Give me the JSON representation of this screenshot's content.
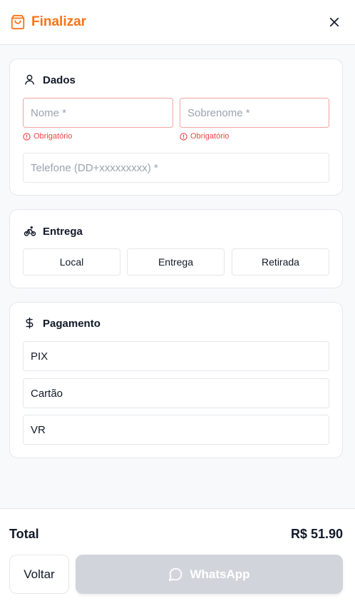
{
  "header": {
    "title": "Finalizar",
    "icon": "shopping-bag-icon",
    "close_icon": "close-icon",
    "accent_color": "#f97316"
  },
  "dados": {
    "title": "Dados",
    "icon": "user-icon",
    "nome_placeholder": "Nome *",
    "sobrenome_placeholder": "Sobrenome *",
    "nome_error": "Obrigatório",
    "sobrenome_error": "Obrigatório",
    "telefone_placeholder": "Telefone (DD+xxxxxxxxx) *",
    "error_color": "#ef4444"
  },
  "entrega": {
    "title": "Entrega",
    "icon": "bicycle-icon",
    "options": [
      "Local",
      "Entrega",
      "Retirada"
    ]
  },
  "pagamento": {
    "title": "Pagamento",
    "icon": "dollar-icon",
    "options": [
      "PIX",
      "Cartão",
      "VR"
    ]
  },
  "footer": {
    "total_label": "Total",
    "total_value": "R$ 51.90",
    "back_label": "Voltar",
    "whatsapp_label": "WhatsApp",
    "whatsapp_icon": "chat-bubble-icon",
    "whatsapp_disabled_color": "#d1d5db"
  }
}
